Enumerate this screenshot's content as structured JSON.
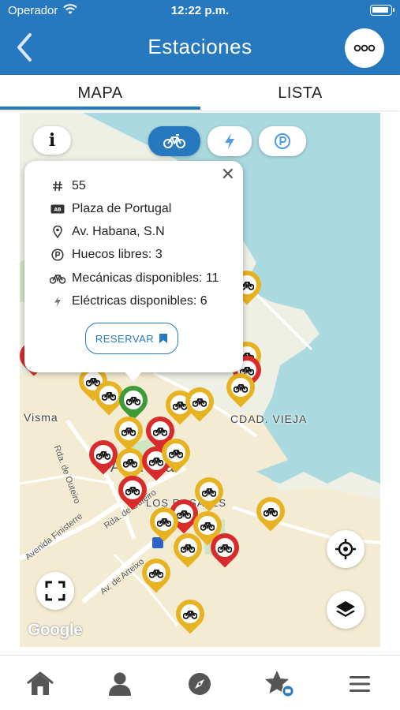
{
  "status_bar": {
    "carrier": "Operador",
    "time": "12:22 p.m."
  },
  "header": {
    "title": "Estaciones"
  },
  "tabs": {
    "map": "MAPA",
    "list": "LISTA",
    "active": "MAPA"
  },
  "map": {
    "info_label": "i",
    "filters": [
      {
        "name": "bikes",
        "icon": "bike-icon",
        "active": true
      },
      {
        "name": "electric",
        "icon": "bolt-icon",
        "active": false
      },
      {
        "name": "parking",
        "icon": "parking-icon",
        "active": false
      }
    ],
    "labels": {
      "visma": "Visma",
      "old_town": "CDAD. VIEJA",
      "city": "Acoruña",
      "district": "LOS ROSALES"
    },
    "streets": {
      "outeiro_1": "Rda. de Outeiro",
      "outeiro_2": "Rda. de Outeiro",
      "finisterre": "Avenida Finisterre",
      "arteixo": "Av. de Arteixo"
    },
    "attribution": "Google",
    "pin_colors": {
      "yellow": "#e8b322",
      "red": "#d92b2b",
      "green": "#3f9a3a"
    }
  },
  "popup": {
    "station_number": "55",
    "station_name": "Plaza de Portugal",
    "address": "Av. Habana, S.N",
    "free_slots": "Huecos libres: 3",
    "mechanical": "Mecánicas disponibles: 11",
    "electric": "Eléctricas disponibles: 6",
    "reserve_label": "RESERVAR"
  },
  "bottom_nav": [
    {
      "name": "home",
      "icon": "home-icon"
    },
    {
      "name": "profile",
      "icon": "user-icon"
    },
    {
      "name": "explore",
      "icon": "compass-icon"
    },
    {
      "name": "favorites",
      "icon": "star-icon"
    },
    {
      "name": "menu",
      "icon": "hamburger-icon"
    }
  ],
  "colors": {
    "primary": "#2678bf"
  }
}
